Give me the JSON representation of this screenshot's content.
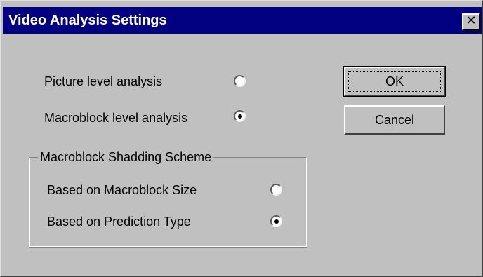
{
  "window": {
    "title": "Video Analysis Settings",
    "close_glyph": "✕"
  },
  "analysis": {
    "options": [
      {
        "label": "Picture level analysis",
        "selected": false
      },
      {
        "label": "Macroblock level analysis",
        "selected": true
      }
    ]
  },
  "shading": {
    "group_label": "Macroblock Shadding Scheme",
    "options": [
      {
        "label": "Based on Macroblock Size",
        "selected": false
      },
      {
        "label": "Based on Prediction Type",
        "selected": true
      }
    ]
  },
  "buttons": {
    "ok_label": "OK",
    "cancel_label": "Cancel"
  }
}
